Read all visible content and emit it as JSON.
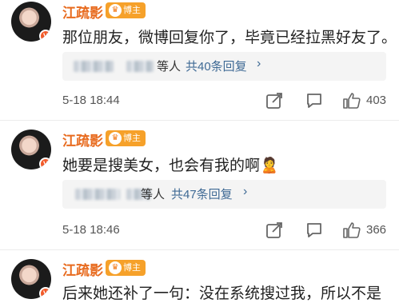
{
  "comments": [
    {
      "author": "江疏影",
      "badge": "博主",
      "text": "那位朋友，微博回复你了，毕竟已经拉黑好友了。",
      "reply_suffix": "等人",
      "reply_count": "共40条回复",
      "time": "5-18 18:44",
      "likes": "403"
    },
    {
      "author": "江疏影",
      "badge": "博主",
      "text": "她要是搜美女，也会有我的啊",
      "emoji": "🙎",
      "reply_suffix": "等人",
      "reply_count": "共47条回复",
      "time": "5-18 18:46",
      "likes": "366"
    },
    {
      "author": "江疏影",
      "badge": "博主",
      "text": "后来她还补了一句：没在系统搜过我，所以不是"
    }
  ],
  "colors": {
    "name": "#e86b1f",
    "badge": "#f6a12a",
    "link": "#3f6a95"
  },
  "icons": [
    "avatar-verified-icon",
    "crown-icon",
    "chevron-right-icon",
    "share-icon",
    "comment-icon",
    "thumbs-up-icon"
  ]
}
